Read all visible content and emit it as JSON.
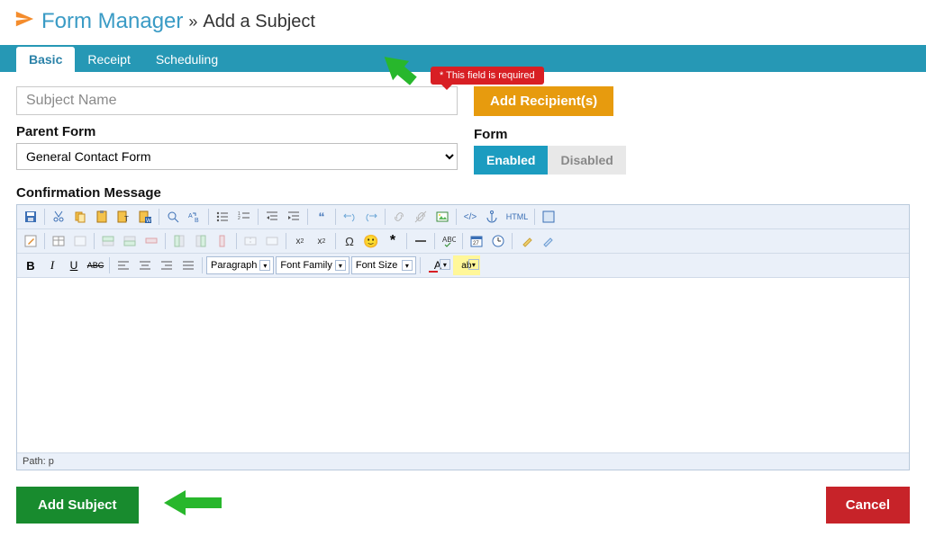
{
  "header": {
    "title": "Form Manager",
    "breadcrumb_sep": "»",
    "breadcrumb": "Add a Subject"
  },
  "tabs": [
    {
      "label": "Basic",
      "active": true
    },
    {
      "label": "Receipt",
      "active": false
    },
    {
      "label": "Scheduling",
      "active": false
    }
  ],
  "tooltip": "* This field is required",
  "left": {
    "subject_placeholder": "Subject Name",
    "parent_label": "Parent Form",
    "parent_selected": "General Contact Form",
    "confirm_label": "Confirmation Message"
  },
  "right": {
    "add_recipients": "Add Recipient(s)",
    "form_label": "Form",
    "enabled": "Enabled",
    "disabled": "Disabled"
  },
  "editor": {
    "row3": {
      "bold": "B",
      "italic": "I",
      "underline": "U",
      "strike": "ABC",
      "paragraph": "Paragraph",
      "font_family": "Font Family",
      "font_size": "Font Size",
      "color_a": "A",
      "hilite": "ab"
    },
    "status": "Path: p",
    "html_label": "HTML"
  },
  "footer": {
    "submit": "Add Subject",
    "cancel": "Cancel"
  },
  "colors": {
    "orange": "#e79b0e",
    "green": "#188b2e",
    "red": "#c72329",
    "blue": "#1c9cc0"
  }
}
